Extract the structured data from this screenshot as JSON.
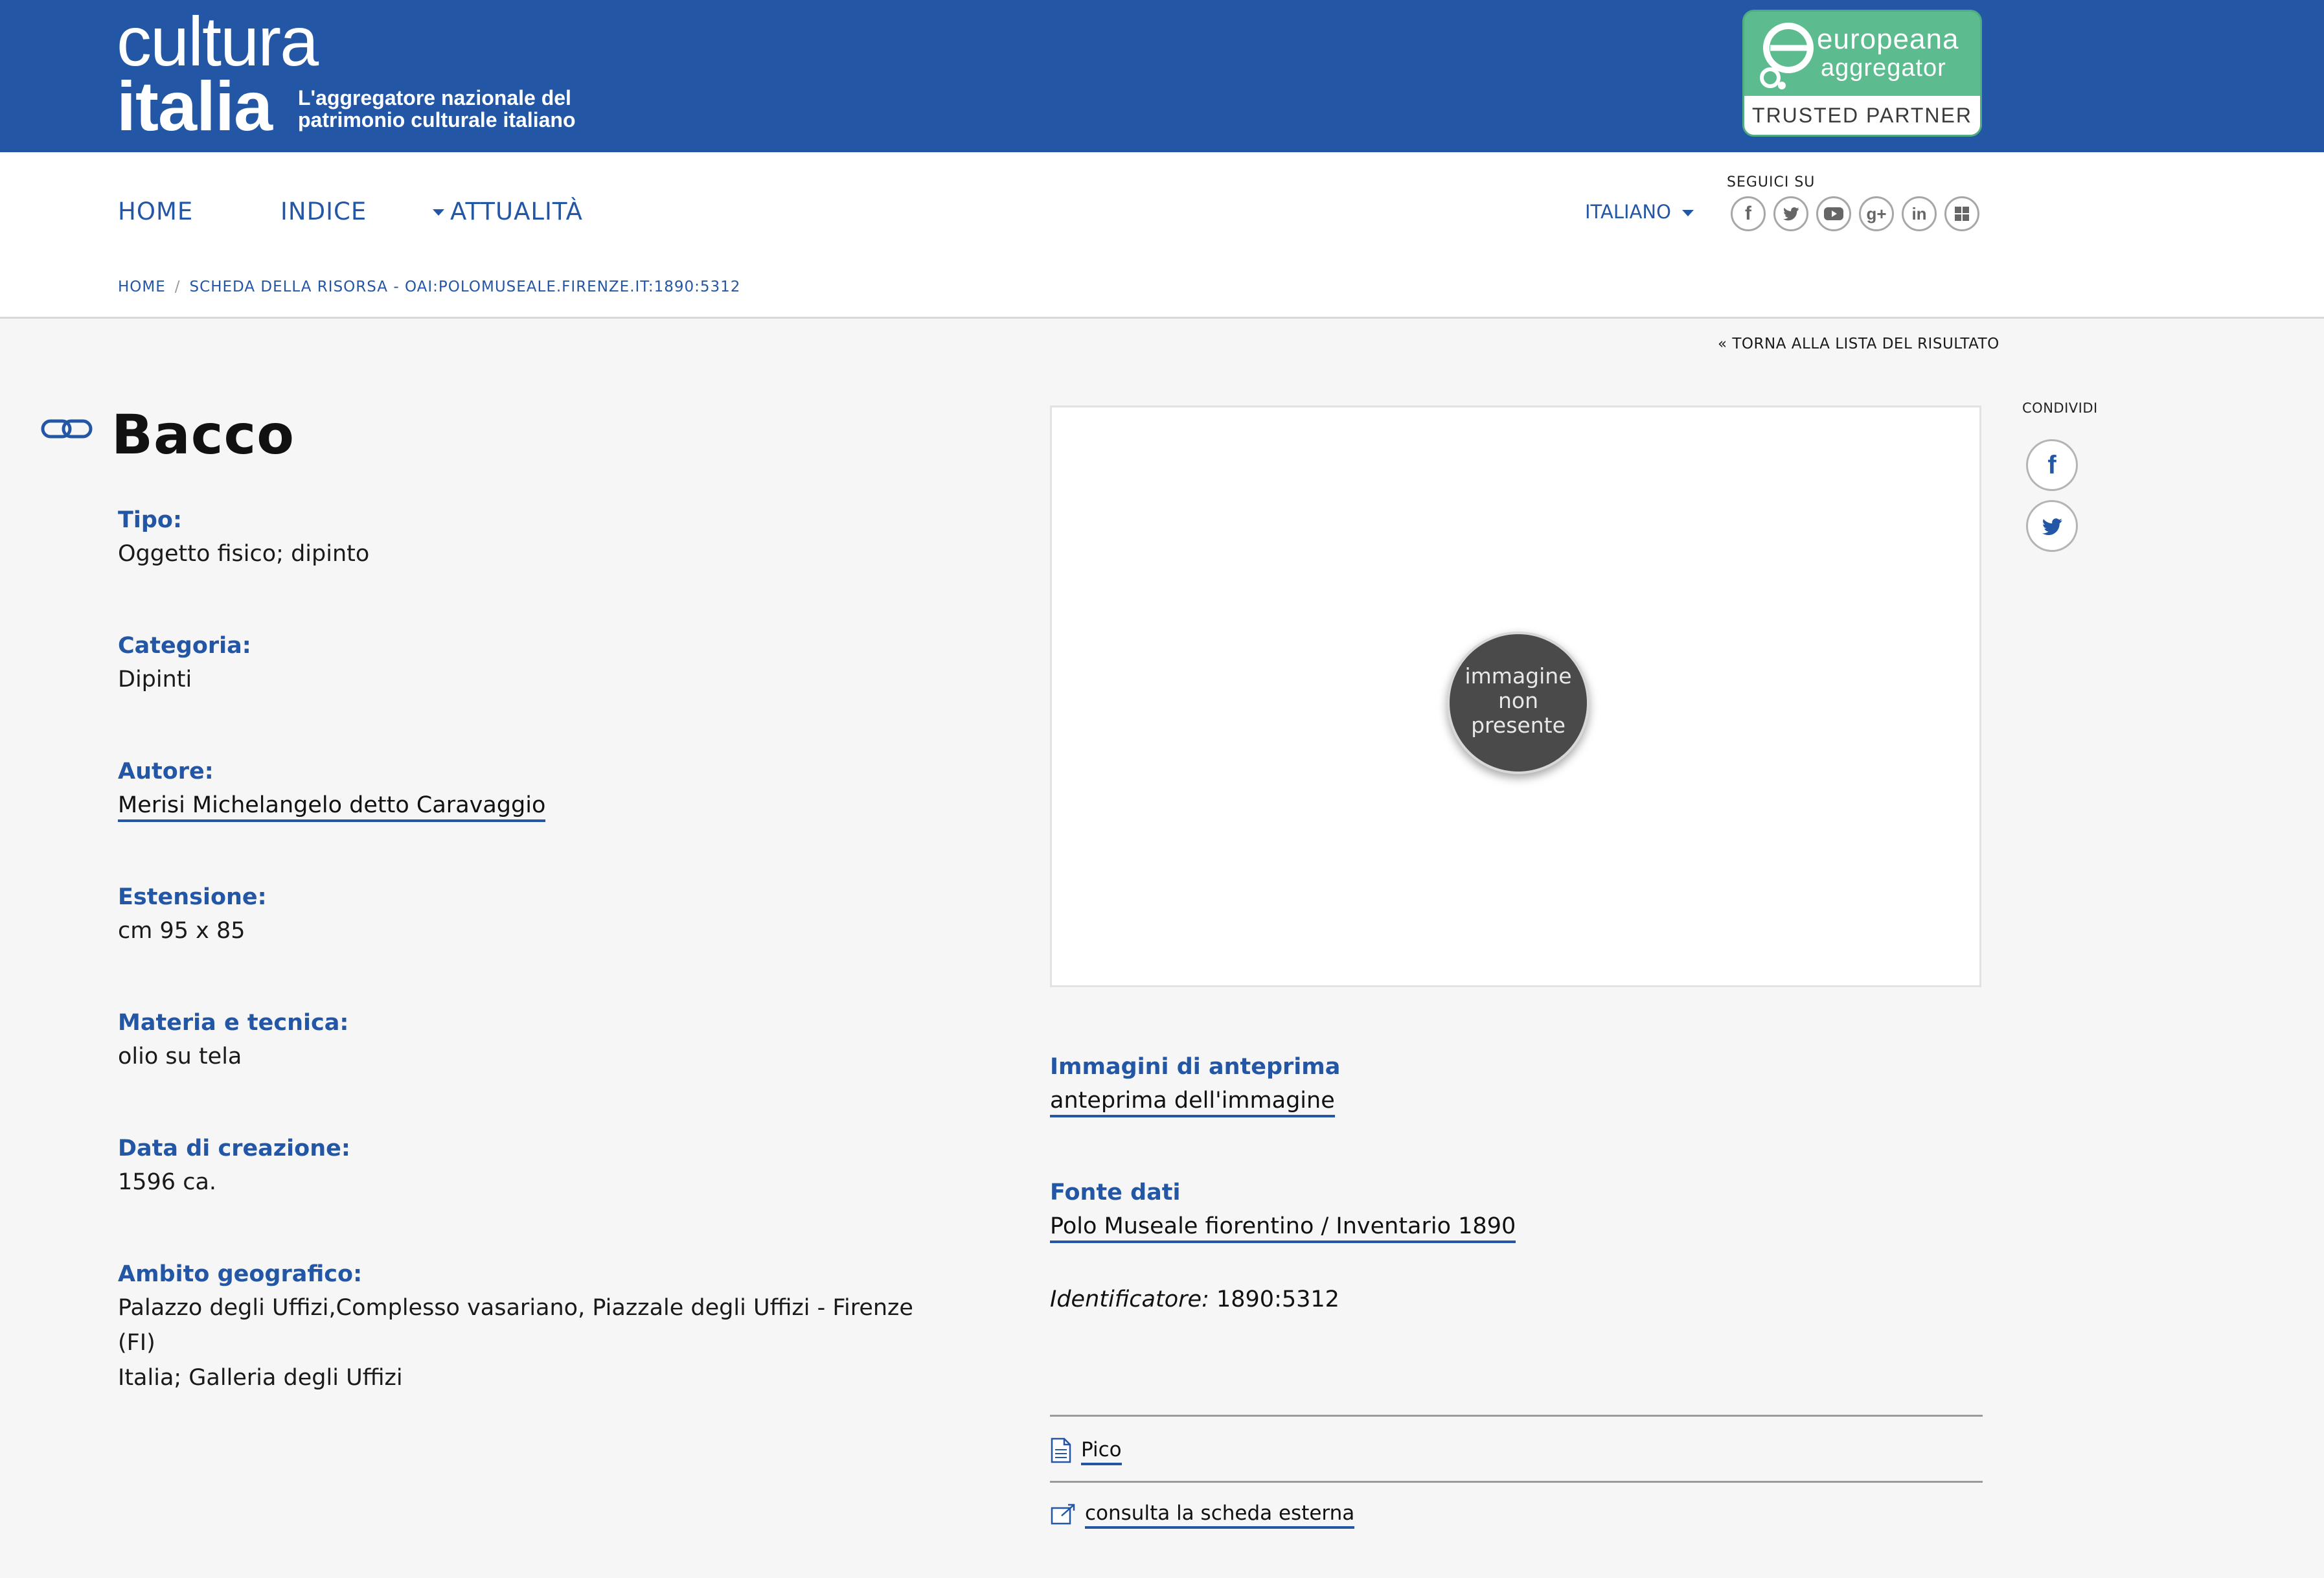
{
  "header": {
    "logo_line1": "cultura",
    "logo_line2": "italia",
    "tagline_1": "L'aggregatore nazionale del",
    "tagline_2": "patrimonio culturale italiano",
    "badge_line1": "europeana",
    "badge_line2": "aggregator",
    "badge_line3": "TRUSTED PARTNER",
    "brand_color": "#2357a6",
    "badge_color": "#5cbc8f"
  },
  "nav": {
    "items": [
      {
        "label": "HOME"
      },
      {
        "label": "INDICE"
      },
      {
        "label": "ATTUALITÀ"
      }
    ],
    "language": "ITALIANO",
    "follow_label": "SEGUICI SU",
    "social_icons": [
      "facebook-icon",
      "twitter-icon",
      "youtube-icon",
      "googleplus-icon",
      "linkedin-icon",
      "delicious-icon"
    ]
  },
  "breadcrumb": {
    "home": "HOME",
    "separator": "/",
    "current": "SCHEDA DELLA RISORSA - OAI:POLOMUSEALE.FIRENZE.IT:1890:5312"
  },
  "back_link": "« TORNA ALLA LISTA DEL RISULTATO",
  "record": {
    "title": "Bacco",
    "fields": [
      {
        "label": "Tipo:",
        "value": "Oggetto fisico; dipinto"
      },
      {
        "label": "Categoria:",
        "value": "Dipinti"
      },
      {
        "label": "Autore:",
        "value": "Merisi Michelangelo detto Caravaggio"
      },
      {
        "label": "Estensione:",
        "value": "cm 95 x 85"
      },
      {
        "label": "Materia e tecnica:",
        "value": "olio su tela"
      },
      {
        "label": "Data di creazione:",
        "value": "1596 ca."
      },
      {
        "label": "Ambito geografico:",
        "value_line1": "Palazzo degli Uffizi,Complesso vasariano, Piazzale degli Uffizi - Firenze (FI)",
        "value_line2": "Italia; Galleria degli Uffizi"
      }
    ]
  },
  "image": {
    "placeholder_line1": "immagine",
    "placeholder_line2": "non",
    "placeholder_line3": "presente"
  },
  "right": {
    "preview_label": "Immagini di anteprima",
    "preview_link": "anteprima dell'immagine",
    "source_label": "Fonte dati",
    "source_link": "Polo Museale fiorentino / Inventario 1890",
    "identifier_key": "Identificatore:",
    "identifier_value": "1890:5312",
    "pico_link": "Pico",
    "external_link": "consulta la scheda esterna"
  },
  "share": {
    "label": "CONDIVIDI",
    "icons": [
      "facebook-icon",
      "twitter-icon"
    ]
  }
}
